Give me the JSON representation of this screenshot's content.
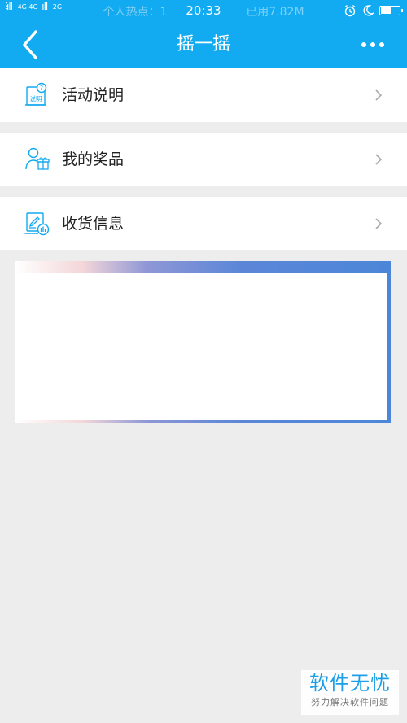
{
  "status_bar": {
    "network_left": "4G 4G",
    "network_right": "2G",
    "hotspot_text": "个人热点：1",
    "time": "20:33",
    "usage_text": "已用7.82M",
    "battery_level": 0.55
  },
  "header": {
    "title": "摇一摇"
  },
  "menu": [
    {
      "label": "活动说明",
      "icon": "instructions-icon",
      "icon_text": "说明"
    },
    {
      "label": "我的奖品",
      "icon": "my-prize-icon"
    },
    {
      "label": "收货信息",
      "icon": "shipping-info-icon"
    }
  ],
  "watermark": {
    "main": "软件无忧",
    "sub": "努力解决软件问题"
  },
  "colors": {
    "primary": "#12aaf0",
    "background": "#ededed",
    "icon": "#12aaf0"
  }
}
